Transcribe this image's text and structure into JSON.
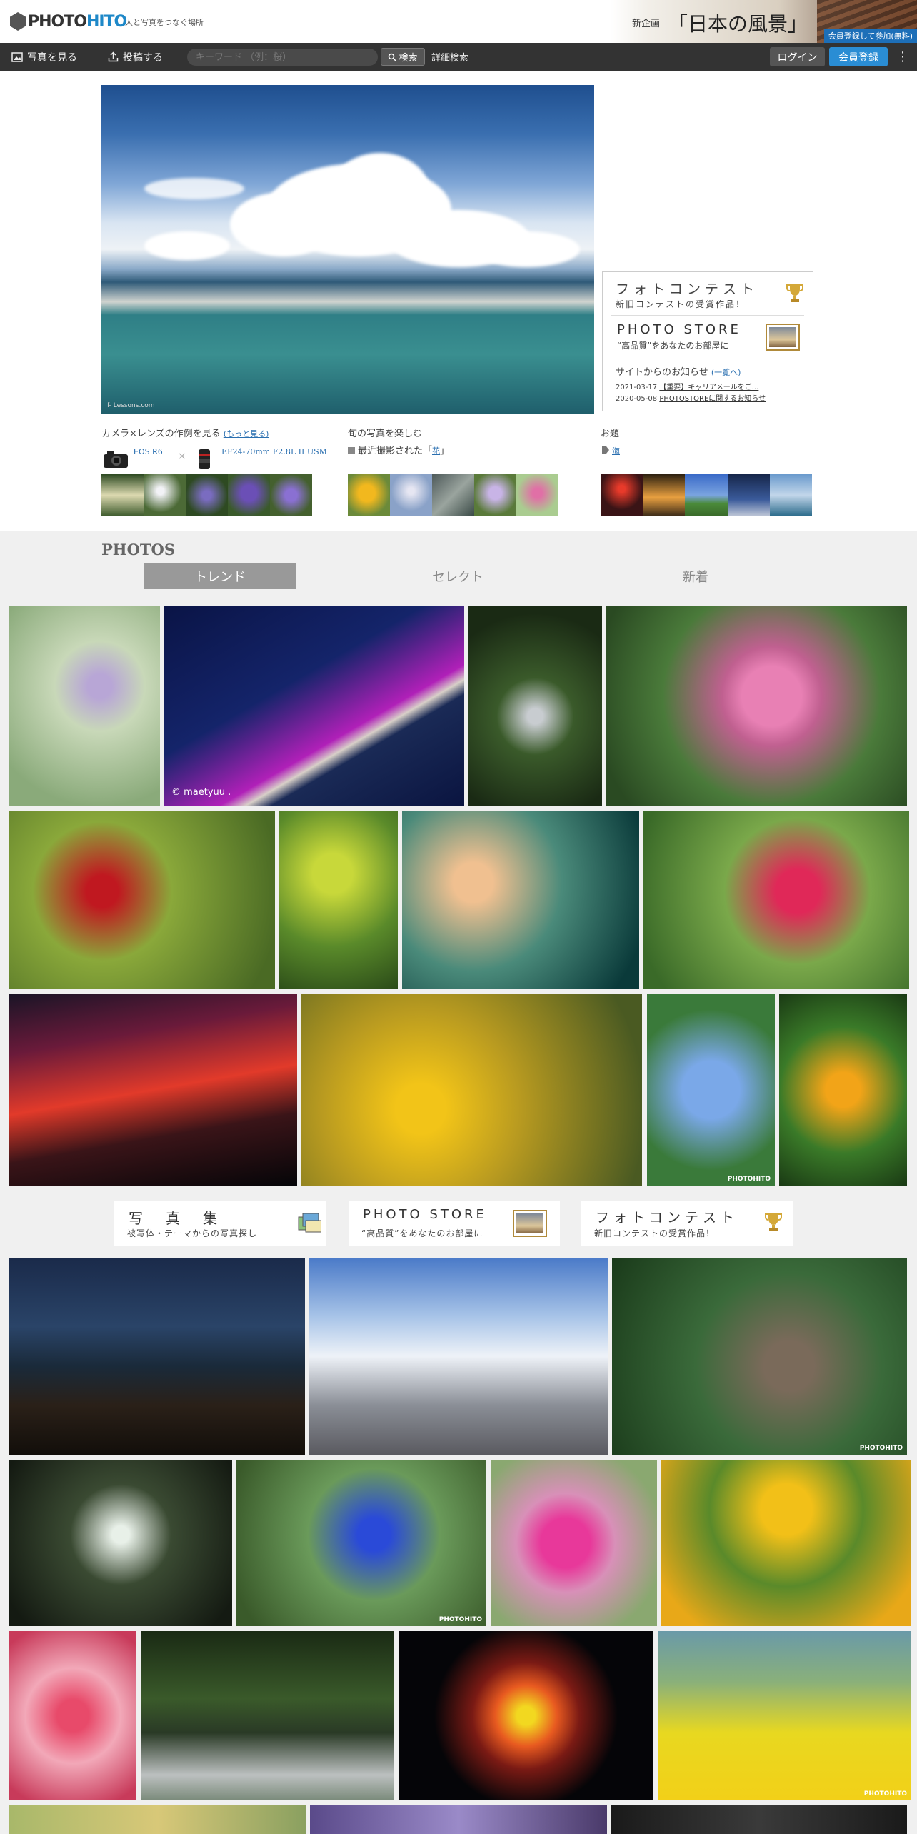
{
  "header": {
    "logo_part1": "PHOTO",
    "logo_part2": "HITO",
    "tagline": "人と写真をつなぐ場所",
    "banner": {
      "lead": "新企画",
      "title": "「日本の風景」",
      "cta": "会員登録して参加(無料)"
    }
  },
  "navbar": {
    "view_photos": "写真を見る",
    "post": "投稿する",
    "search_placeholder": "キーワード （例：桜）",
    "search_button": "検索",
    "advanced_search": "詳細検索",
    "login": "ログイン",
    "signup": "会員登録",
    "more": "⋮"
  },
  "hero": {
    "credit": "f- Lessons.com"
  },
  "infobox": {
    "contest_title": "フォトコンテスト",
    "contest_sub": "新旧コンテストの受賞作品！",
    "store_title": "PHOTO STORE",
    "store_sub": "“高品質”をあなたのお部屋に",
    "news_title": "サイトからのお知らせ",
    "news_list_link": "(一覧へ)",
    "news": [
      {
        "date": "2021-03-17",
        "text": "【重要】キャリアメールをご..."
      },
      {
        "date": "2020-05-08",
        "text": "PHOTOSTOREに関するお知らせ"
      }
    ]
  },
  "blocks": {
    "camera": {
      "title": "カメラ×レンズの作例を見る",
      "more": "(もっと見る)",
      "camera_name": "EOS R6",
      "times": "×",
      "lens_name": "EF24-70mm F2.8L II USM"
    },
    "seasonal": {
      "title": "旬の写真を楽しむ",
      "label": "最近撮影された「",
      "tag": "花",
      "label_end": "」"
    },
    "topic": {
      "title": "お題",
      "tag": "海"
    }
  },
  "photos": {
    "heading": "PHOTOS",
    "tabs": [
      "トレンド",
      "セレクト",
      "新着"
    ],
    "credit": "© maetyuu .",
    "watermark": "PHOTOHITO"
  },
  "promos": [
    {
      "title": "写　真　集",
      "sub": "被写体・テーマからの写真探し"
    },
    {
      "title": "PHOTO STORE",
      "sub": "“高品質”をあなたのお部屋に"
    },
    {
      "title": "フォトコンテスト",
      "sub": "新旧コンテストの受賞作品！"
    }
  ],
  "colors": {
    "navbar": "#333333",
    "accent": "#2a8dd4",
    "band": "#f0f0f0"
  }
}
